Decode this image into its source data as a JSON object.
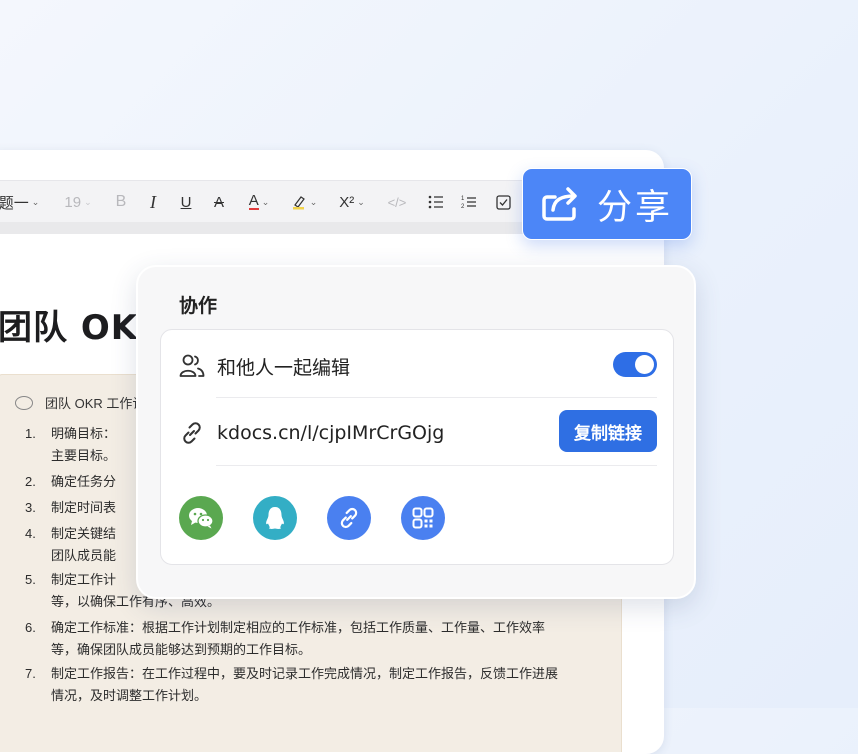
{
  "toolbar": {
    "heading_label": "题一",
    "font_size": "19",
    "bold": "B",
    "italic": "I",
    "underline": "U",
    "strike": "A",
    "font_color": "A",
    "superscript": "X²",
    "code": "</>"
  },
  "document": {
    "title": "团队 OKR",
    "comment": "团队 OKR 工作计",
    "items": [
      {
        "num": "1.",
        "text": "明确目标：",
        "cont": "主要目标。"
      },
      {
        "num": "2.",
        "text": "确定任务分"
      },
      {
        "num": "3.",
        "text": "制定时间表"
      },
      {
        "num": "4.",
        "text": "制定关键结",
        "cont": "团队成员能"
      },
      {
        "num": "5.",
        "text": "制定工作计",
        "cont": "等，以确保工作有序、高效。"
      },
      {
        "num": "6.",
        "text": "确定工作标准：根据工作计划制定相应的工作标准，包括工作质量、工作量、工作效率",
        "cont": "等，确保团队成员能够达到预期的工作目标。"
      },
      {
        "num": "7.",
        "text": "制定工作报告：在工作过程中，要及时记录工作完成情况，制定工作报告，反馈工作进展",
        "cont": "情况，及时调整工作计划。"
      }
    ]
  },
  "share_button": {
    "label": "分享",
    "icon": "share-icon"
  },
  "panel": {
    "title": "协作",
    "collab_label": "和他人一起编辑",
    "collab_enabled": true,
    "link": "kdocs.cn/l/cjpIMrCrGOjg",
    "copy_label": "复制链接",
    "share_targets": [
      "wechat-icon",
      "qq-icon",
      "link-icon",
      "qrcode-icon"
    ]
  },
  "colors": {
    "accent": "#2f6fe3",
    "share_button": "#4c86f7",
    "wechat": "#5aa850",
    "qq": "#33aec5"
  }
}
